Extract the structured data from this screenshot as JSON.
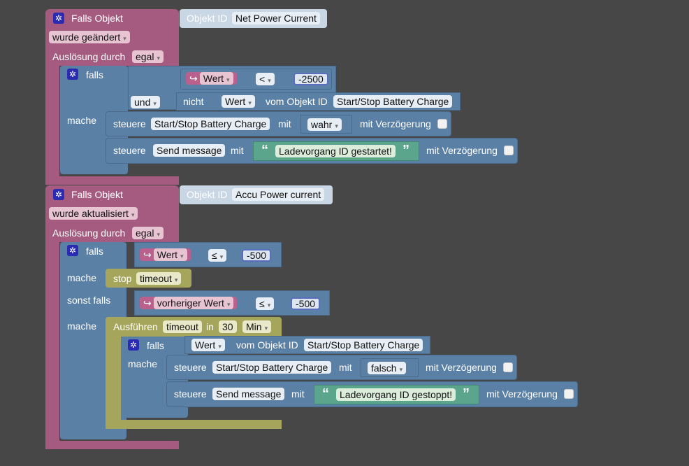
{
  "trigger1": {
    "header": "Falls Objekt",
    "obj_label": "Objekt ID",
    "obj_value": "Net Power Current",
    "change_mode": "wurde geändert",
    "trigger_label": "Auslösung durch",
    "trigger_value": "egal",
    "if_label": "falls",
    "do_label": "mache",
    "cond1": {
      "var": "Wert",
      "op": "<",
      "value": "-2500"
    },
    "cond2": {
      "logic": "und",
      "not_label": "nicht",
      "var": "Wert",
      "from_label": "vom Objekt ID",
      "obj": "Start/Stop Battery Charge"
    },
    "action1": {
      "steuere_label": "steuere",
      "target": "Start/Stop Battery Charge",
      "with_label": "mit",
      "value": "wahr",
      "delay_label": "mit Verzögerung"
    },
    "action2": {
      "steuere_label": "steuere",
      "target": "Send message",
      "with_label": "mit",
      "text": "Ladevorgang ID gestartet!",
      "delay_label": "mit Verzögerung"
    }
  },
  "trigger2": {
    "header": "Falls Objekt",
    "obj_label": "Objekt ID",
    "obj_value": "Accu Power current",
    "change_mode": "wurde aktualisiert",
    "trigger_label": "Auslösung durch",
    "trigger_value": "egal",
    "if_label": "falls",
    "do_label": "mache",
    "elseif_label": "sonst falls",
    "do2_label": "mache",
    "cond1": {
      "var": "Wert",
      "op": "≤",
      "value": "-500"
    },
    "stop": {
      "label": "stop",
      "value": "timeout"
    },
    "cond2": {
      "var": "vorheriger Wert",
      "op": "≤",
      "value": "-500"
    },
    "timeout": {
      "label": "Ausführen",
      "name": "timeout",
      "in_label": "in",
      "amount": "30",
      "unit": "Min"
    },
    "inner_if": {
      "if_label": "falls",
      "do_label": "mache",
      "var": "Wert",
      "from_label": "vom Objekt ID",
      "obj": "Start/Stop Battery Charge"
    },
    "action1": {
      "steuere_label": "steuere",
      "target": "Start/Stop Battery Charge",
      "with_label": "mit",
      "value": "falsch",
      "delay_label": "mit Verzögerung"
    },
    "action2": {
      "steuere_label": "steuere",
      "target": "Send message",
      "with_label": "mit",
      "text": "Ladevorgang ID gestoppt!",
      "delay_label": "mit Verzögerung"
    }
  },
  "icons": {
    "gear": "gear-icon",
    "arrow": "variable-arrow-icon",
    "dropdown": "dropdown-arrow-icon"
  },
  "colors": {
    "event": "#a55b80",
    "logic": "#5b80a5",
    "timer": "#a5a55b",
    "background": "#474747"
  }
}
